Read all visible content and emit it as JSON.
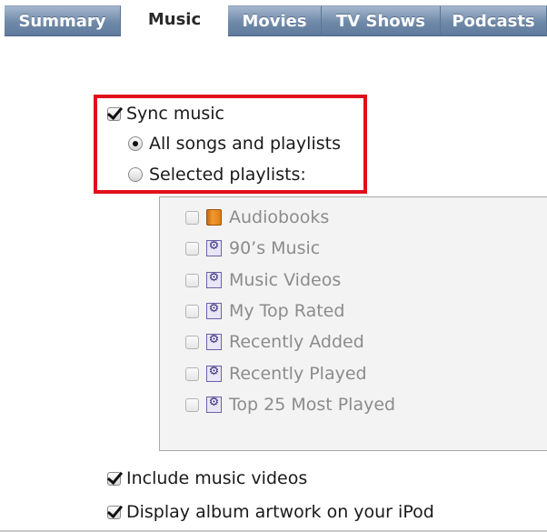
{
  "tabs": [
    {
      "id": "summary",
      "label": "Summary",
      "active": false
    },
    {
      "id": "music",
      "label": "Music",
      "active": true
    },
    {
      "id": "movies",
      "label": "Movies",
      "active": false
    },
    {
      "id": "tvshows",
      "label": "TV Shows",
      "active": false
    },
    {
      "id": "podcasts",
      "label": "Podcasts",
      "active": false
    }
  ],
  "sync": {
    "label": "Sync music",
    "checked": true,
    "options": [
      {
        "label": "All songs and playlists",
        "selected": true
      },
      {
        "label": "Selected playlists:",
        "selected": false
      }
    ]
  },
  "playlists": [
    {
      "label": "Audiobooks",
      "icon": "audiobook-icon",
      "checked": false
    },
    {
      "label": "90’s Music",
      "icon": "smart-playlist-icon",
      "checked": false
    },
    {
      "label": "Music Videos",
      "icon": "smart-playlist-icon",
      "checked": false
    },
    {
      "label": "My Top Rated",
      "icon": "smart-playlist-icon",
      "checked": false
    },
    {
      "label": "Recently Added",
      "icon": "smart-playlist-icon",
      "checked": false
    },
    {
      "label": "Recently Played",
      "icon": "smart-playlist-icon",
      "checked": false
    },
    {
      "label": "Top 25 Most Played",
      "icon": "smart-playlist-icon",
      "checked": false
    }
  ],
  "options": {
    "include_videos": {
      "label": "Include music videos",
      "checked": true
    },
    "display_artwork": {
      "label": "Display album artwork on your iPod",
      "checked": true
    }
  },
  "colors": {
    "highlight": "#e0101b",
    "tab_blue": "#6f89a9",
    "disabled_text": "#8c8c8c"
  }
}
